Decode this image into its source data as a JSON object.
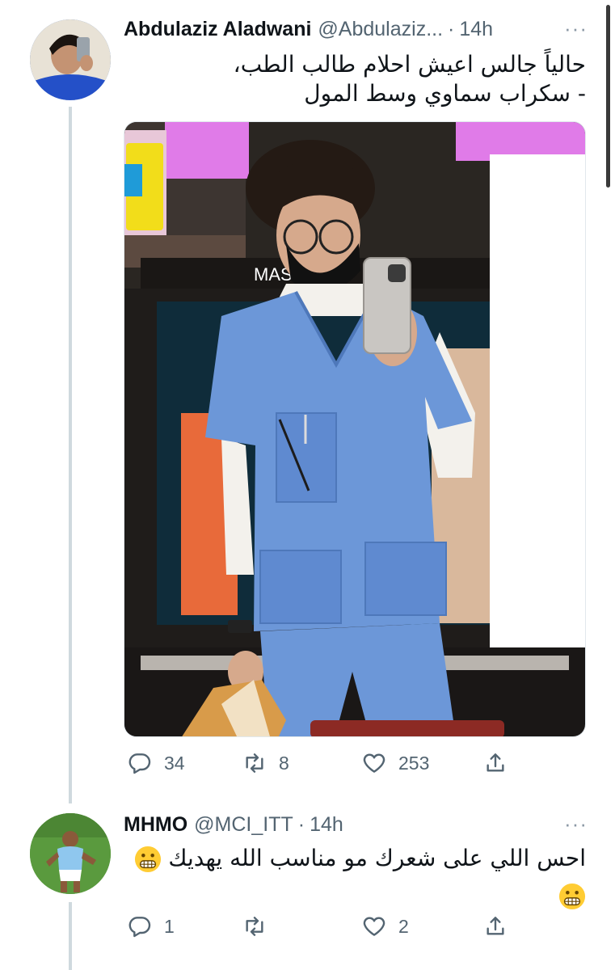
{
  "tweets": [
    {
      "author_name": "Abdulaziz Aladwani",
      "handle": "@Abdulaziz...",
      "separator": "·",
      "time": "14h",
      "more": "···",
      "text_lines": [
        "حالياً جالس اعيش احلام طالب الطب،",
        "- سكراب سماوي وسط المول"
      ],
      "media_description_icon": "photo-mirror-selfie",
      "photo_sign_text": "MASK",
      "actions": {
        "replies": "34",
        "retweets": "8",
        "likes": "253"
      }
    },
    {
      "author_name": "MHMO",
      "handle": "@MCI_ITT",
      "separator": "·",
      "time": "14h",
      "more": "···",
      "text_line": "احس اللي على شعرك مو مناسب الله يهديك",
      "emoji": "grimacing-face",
      "actions": {
        "replies": "1",
        "retweets": "",
        "likes": "2"
      }
    }
  ],
  "colors": {
    "thread_line": "#cfd9de",
    "secondary_text": "#536471",
    "scrub_blue": "#6c97d8"
  }
}
